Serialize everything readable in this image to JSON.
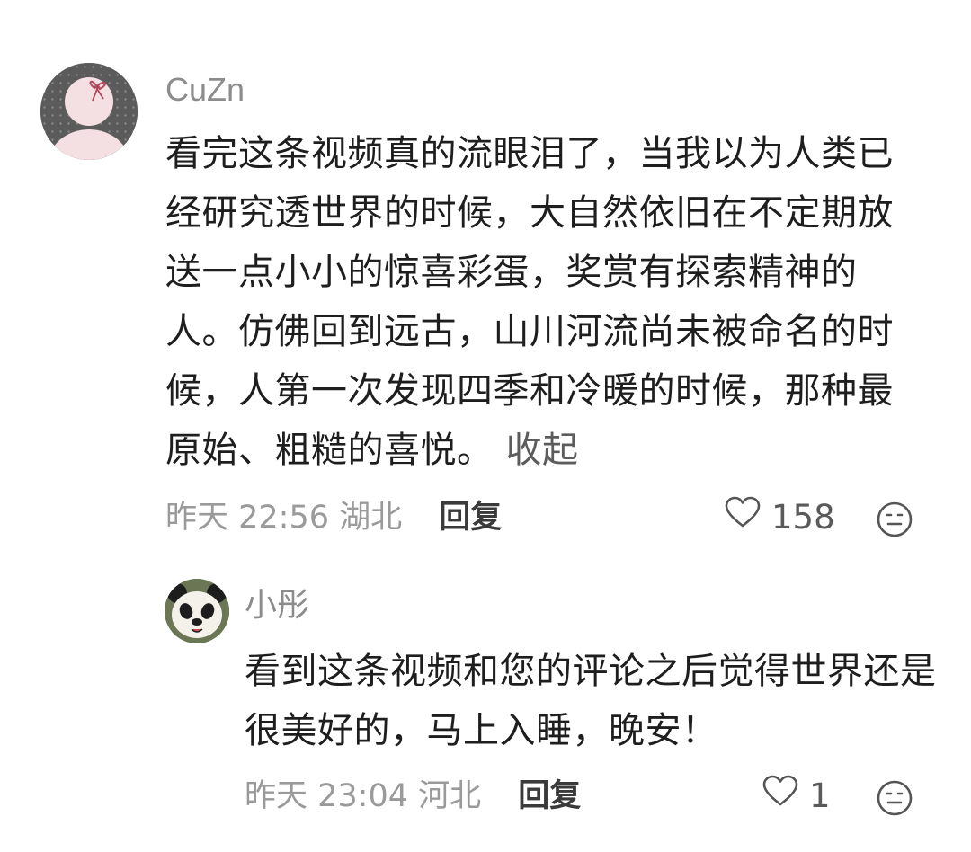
{
  "comment": {
    "username": "CuZn",
    "text": "看完这条视频真的流眼泪了，当我以为人类已经研究透世界的时候，大自然依旧在不定期放送一点小小的惊喜彩蛋，奖赏有探索精神的人。仿佛回到远古，山川河流尚未被命名的时候，人第一次发现四季和冷暖的时候，那种最原始、粗糙的喜悦。",
    "collapse_label": "收起",
    "time": "昨天 22:56",
    "location": "湖北",
    "reply_label": "回复",
    "like_count": "158",
    "avatar_icon": "pink-bow-avatar",
    "emoji_icon": "neutral-face-icon",
    "like_icon": "heart-outline-icon"
  },
  "reply": {
    "username": "小彤",
    "text": "看到这条视频和您的评论之后觉得世界还是很美好的，马上入睡，晚安！",
    "time": "昨天 23:04",
    "location": "河北",
    "reply_label": "回复",
    "like_count": "1",
    "avatar_icon": "panda-avatar",
    "emoji_icon": "neutral-face-icon",
    "like_icon": "heart-outline-icon"
  },
  "colors": {
    "text_primary": "#1e1e1e",
    "text_secondary": "#9a9a9a",
    "username": "#8c8c8c",
    "action": "#3a3a3a"
  }
}
